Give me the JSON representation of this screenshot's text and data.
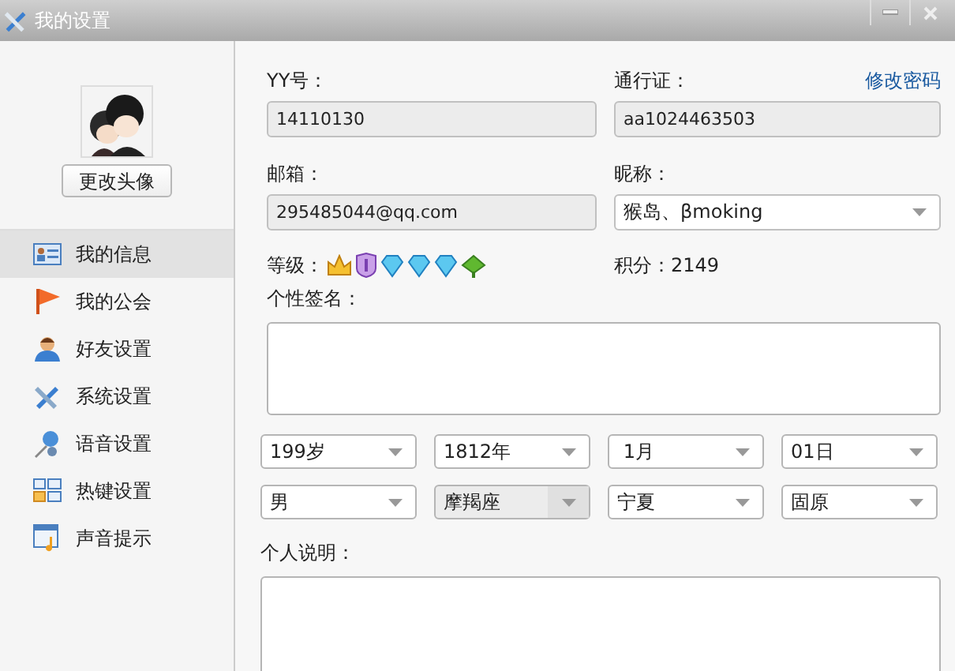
{
  "window": {
    "title": "我的设置"
  },
  "sidebar": {
    "change_avatar_button": "更改头像",
    "items": [
      {
        "label": "我的信息",
        "selected": true
      },
      {
        "label": "我的公会",
        "selected": false
      },
      {
        "label": "好友设置",
        "selected": false
      },
      {
        "label": "系统设置",
        "selected": false
      },
      {
        "label": "语音设置",
        "selected": false
      },
      {
        "label": "热键设置",
        "selected": false
      },
      {
        "label": "声音提示",
        "selected": false
      }
    ]
  },
  "form": {
    "yy_label": "YY号：",
    "yy_value": "14110130",
    "pass_label": "通行证：",
    "change_password_link": "修改密码",
    "pass_value": "aa1024463503",
    "email_label": "邮箱：",
    "email_value": "295485044@qq.com",
    "nick_label": "昵称：",
    "nick_value": "猴岛、βmoking",
    "level_label": "等级：",
    "points": "积分：2149",
    "signature_label": "个性签名：",
    "selects": [
      {
        "value": "199岁",
        "disabled": false
      },
      {
        "value": "1812年",
        "disabled": false
      },
      {
        "value": " 1月",
        "disabled": false
      },
      {
        "value": "01日",
        "disabled": false
      },
      {
        "value": "男",
        "disabled": false
      },
      {
        "value": "摩羯座",
        "disabled": true
      },
      {
        "value": "宁夏",
        "disabled": false
      },
      {
        "value": "固原",
        "disabled": false
      }
    ],
    "about_label": "个人说明："
  }
}
